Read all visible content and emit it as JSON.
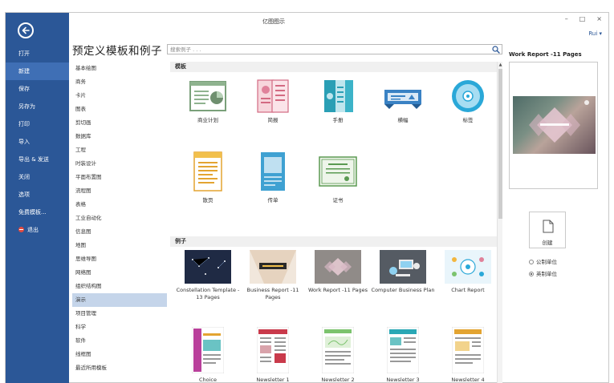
{
  "app": {
    "title": "亿图图示"
  },
  "window_controls": {
    "minimize": "–",
    "maximize": "□",
    "close": "×"
  },
  "user": {
    "label": "Rui ▾"
  },
  "sidebar": {
    "items": [
      {
        "label": "打开"
      },
      {
        "label": "新建",
        "active": true
      },
      {
        "label": "保存"
      },
      {
        "label": "另存为"
      },
      {
        "label": "打印"
      },
      {
        "label": "导入"
      },
      {
        "label": "导出 & 发送"
      },
      {
        "label": "关闭"
      },
      {
        "label": "选项"
      },
      {
        "label": "免费模板..."
      },
      {
        "label": "退出"
      }
    ]
  },
  "heading": "预定义模板和例子",
  "search": {
    "placeholder": "搜索例子 . . ."
  },
  "categories": [
    "基本绘图",
    "商务",
    "卡片",
    "图表",
    "剪切画",
    "数据库",
    "工程",
    "时装设计",
    "平面布置图",
    "流程图",
    "表格",
    "工业自动化",
    "信息图",
    "地图",
    "思维导图",
    "网络图",
    "组织结构图",
    "演示",
    "项目管理",
    "科学",
    "软件",
    "线框图",
    "最近所用模板"
  ],
  "selected_category": "演示",
  "templates": {
    "header": "模板",
    "items": [
      {
        "label": "商业计划",
        "icon": "business-plan-icon"
      },
      {
        "label": "简报",
        "icon": "brochure-icon"
      },
      {
        "label": "手册",
        "icon": "handbook-icon"
      },
      {
        "label": "横幅",
        "icon": "banner-icon"
      },
      {
        "label": "标签",
        "icon": "label-disc-icon"
      },
      {
        "label": "散页",
        "icon": "flyer-icon"
      },
      {
        "label": "传单",
        "icon": "leaflet-icon"
      },
      {
        "label": "证书",
        "icon": "certificate-icon"
      }
    ]
  },
  "examples": {
    "header": "例子",
    "items": [
      {
        "label": "Constellation Template - 13 Pages"
      },
      {
        "label": "Business Report -11 Pages"
      },
      {
        "label": "Work Report -11 Pages"
      },
      {
        "label": "Computer Business Plan"
      },
      {
        "label": "Chart Report"
      },
      {
        "label": "Choice"
      },
      {
        "label": "Newsletter 1"
      },
      {
        "label": "Newsletter 2"
      },
      {
        "label": "Newsletter 3"
      },
      {
        "label": "Newsletter 4"
      }
    ]
  },
  "preview": {
    "title": "Work Report -11 Pages",
    "create_label": "创建",
    "units": [
      {
        "label": "公制单位",
        "checked": false
      },
      {
        "label": "英制单位",
        "checked": true
      }
    ]
  },
  "colors": {
    "sidebar": "#2b5797",
    "sidebar_active": "#3f6fb5",
    "selected_category": "#c5d5ea",
    "accent": "#2b5797"
  }
}
